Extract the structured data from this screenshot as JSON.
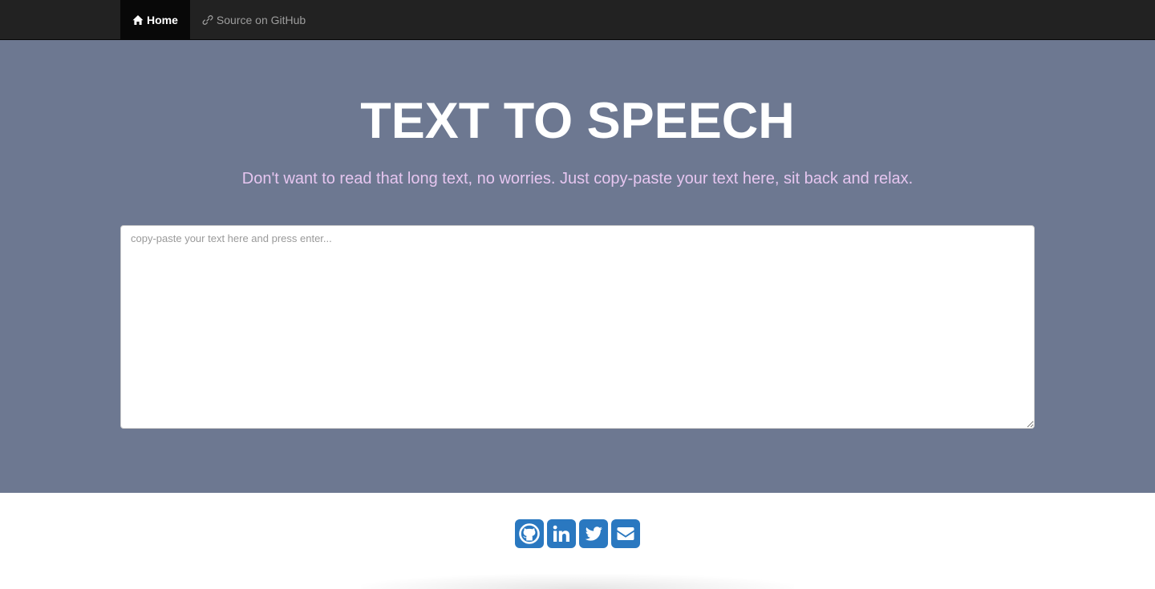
{
  "nav": {
    "items": [
      {
        "label": "Home",
        "icon": "home-icon",
        "active": true
      },
      {
        "label": "Source on GitHub",
        "icon": "link-icon",
        "active": false
      }
    ]
  },
  "hero": {
    "title": "TEXT TO SPEECH",
    "subtitle": "Don't want to read that long text, no worries. Just copy-paste your text here, sit back and relax.",
    "input": {
      "placeholder": "copy-paste your text here and press enter...",
      "value": ""
    }
  },
  "social": {
    "links": [
      "github-icon",
      "linkedin-icon",
      "twitter-icon",
      "envelope-icon"
    ]
  },
  "colors": {
    "navbar": "#222222",
    "hero_background": "#6d7891",
    "title": "#ffffff",
    "subtitle": "#e6c6f0",
    "social_button": "#2a78c0"
  }
}
